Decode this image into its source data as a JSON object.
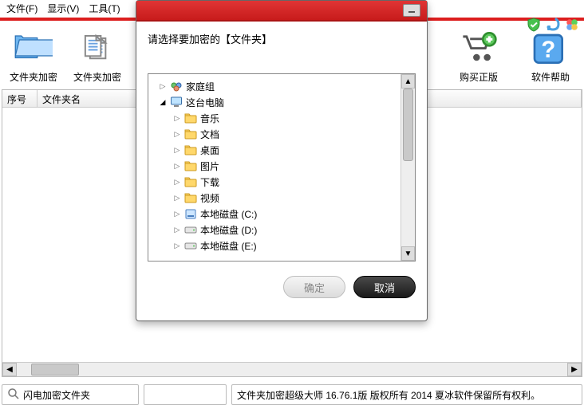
{
  "menubar": {
    "file": "文件(F)",
    "view": "显示(V)",
    "tool": "工具(T)"
  },
  "toolbar": {
    "left": [
      {
        "id": "folder-encrypt-a",
        "label": "文件夹加密"
      },
      {
        "id": "folder-encrypt-b",
        "label": "文件夹加密"
      }
    ],
    "right": [
      {
        "id": "buy",
        "label": "购买正版"
      },
      {
        "id": "help",
        "label": "软件帮助"
      }
    ]
  },
  "grid": {
    "col_index": "序号",
    "col_name": "文件夹名"
  },
  "dialog": {
    "title_cut": "",
    "prompt": "请选择要加密的【文件夹】",
    "ok": "确定",
    "cancel": "取消",
    "tree": {
      "homegroup": "家庭组",
      "this_pc": "这台电脑",
      "children": [
        {
          "id": "music",
          "label": "音乐"
        },
        {
          "id": "docs",
          "label": "文档"
        },
        {
          "id": "desktop",
          "label": "桌面"
        },
        {
          "id": "pics",
          "label": "图片"
        },
        {
          "id": "down",
          "label": "下载"
        },
        {
          "id": "video",
          "label": "视频"
        },
        {
          "id": "drive-c",
          "label": "本地磁盘 (C:)",
          "kind": "hdd"
        },
        {
          "id": "drive-d",
          "label": "本地磁盘 (D:)",
          "kind": "disk"
        },
        {
          "id": "drive-e",
          "label": "本地磁盘 (E:)",
          "kind": "disk"
        }
      ]
    }
  },
  "status": {
    "left_text": "闪电加密文件夹",
    "right_text": "文件夹加密超级大师 16.76.1版 版权所有 2014 夏冰软件保留所有权利。"
  }
}
